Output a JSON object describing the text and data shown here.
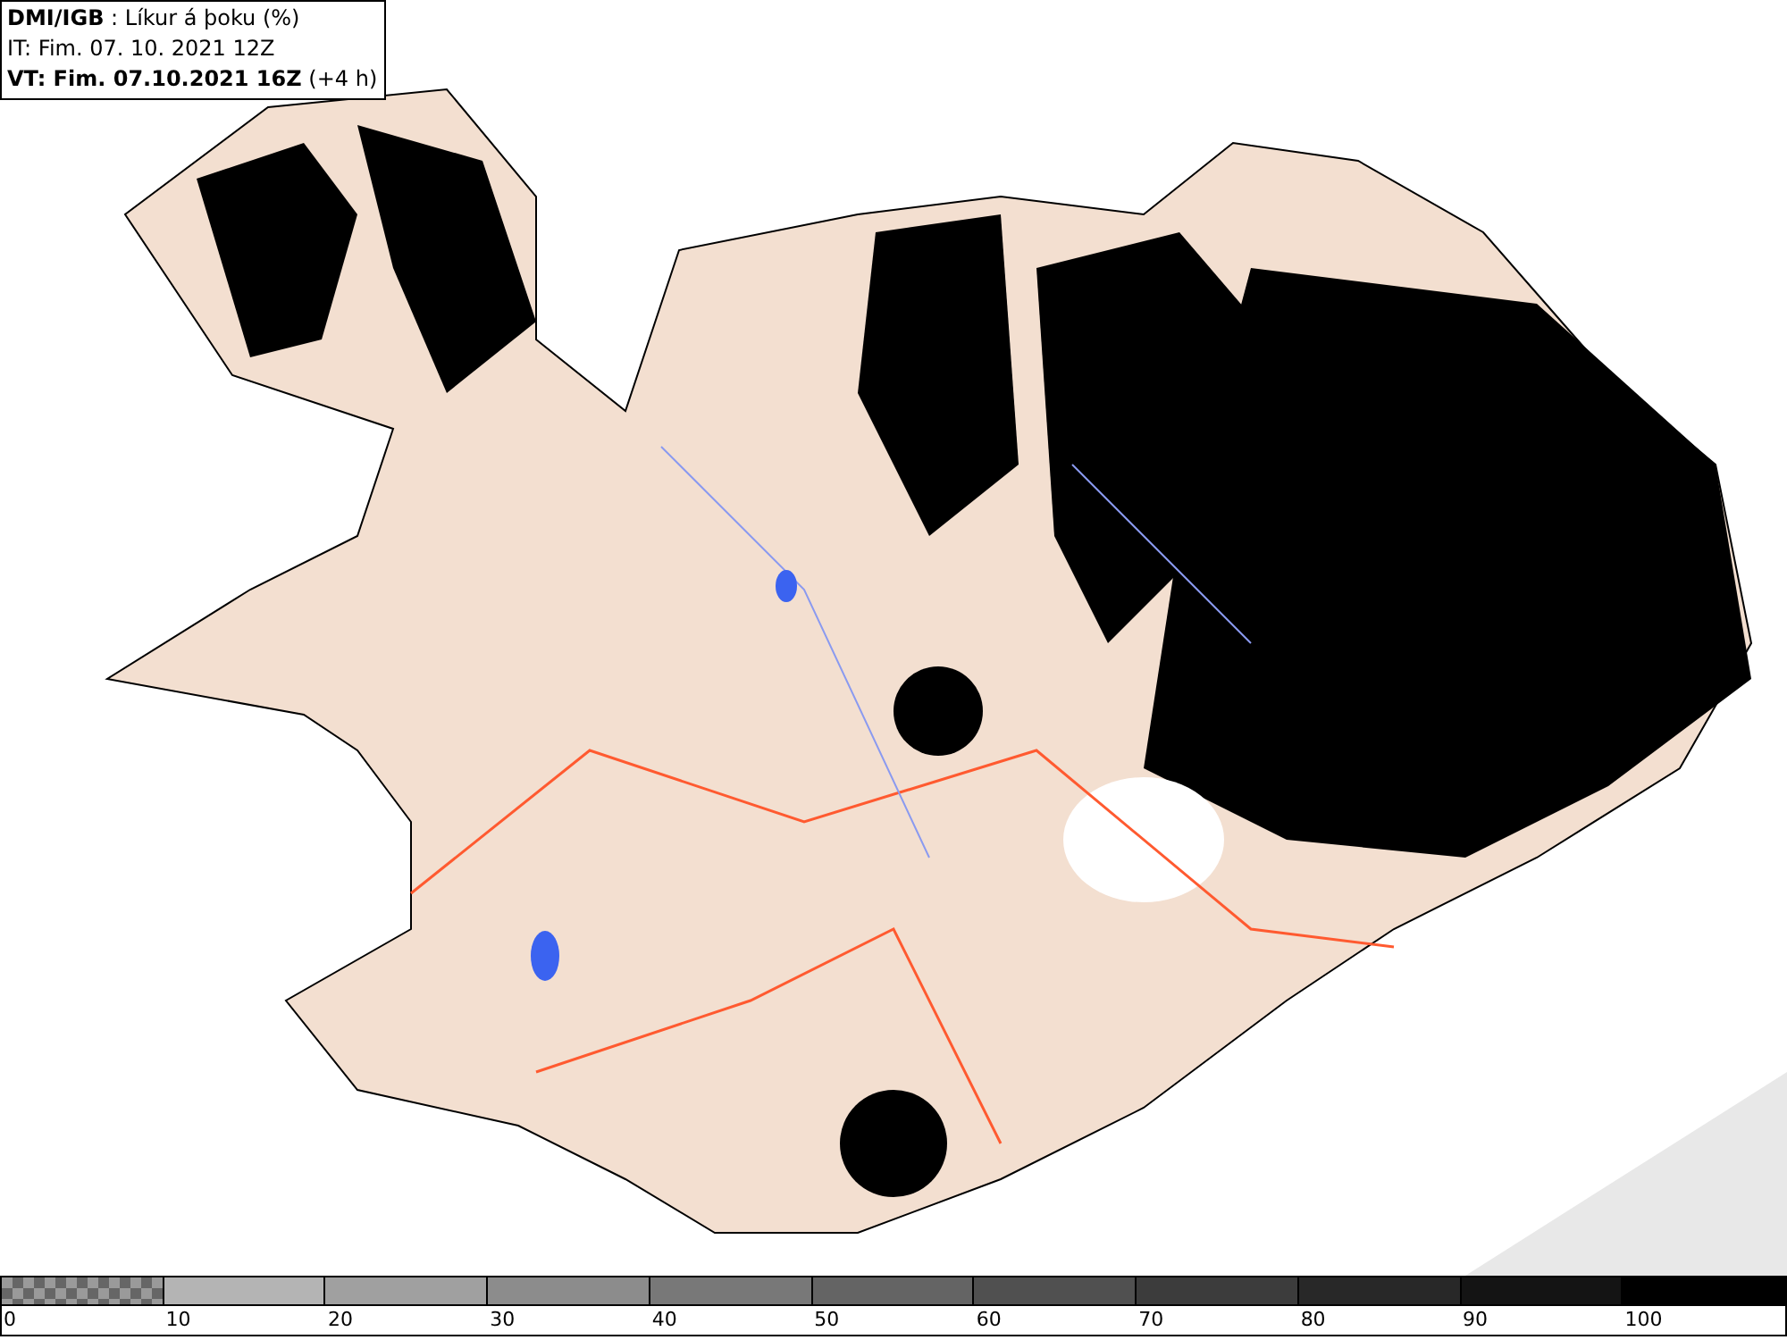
{
  "info_box": {
    "lines": [
      "**DMI/IGB** : Líkur á þoku (%)",
      "IT: Fim. 07. 10. 2021 12Z",
      "**VT: Fim. 07.10.2021 16Z** (+4 h)"
    ]
  },
  "legend": {
    "segments": [
      {
        "kind": "checker",
        "color": "#9a9a9a",
        "label": "0"
      },
      {
        "kind": "solid",
        "color": "#b4b4b4",
        "label": "10"
      },
      {
        "kind": "solid",
        "color": "#a0a0a0",
        "label": "20"
      },
      {
        "kind": "solid",
        "color": "#8c8c8c",
        "label": "30"
      },
      {
        "kind": "solid",
        "color": "#787878",
        "label": "40"
      },
      {
        "kind": "solid",
        "color": "#646464",
        "label": "50"
      },
      {
        "kind": "solid",
        "color": "#505050",
        "label": "60"
      },
      {
        "kind": "solid",
        "color": "#3c3c3c",
        "label": "70"
      },
      {
        "kind": "solid",
        "color": "#282828",
        "label": "80"
      },
      {
        "kind": "solid",
        "color": "#141414",
        "label": "90"
      },
      {
        "kind": "solid",
        "color": "#000000",
        "label": "100"
      }
    ]
  }
}
